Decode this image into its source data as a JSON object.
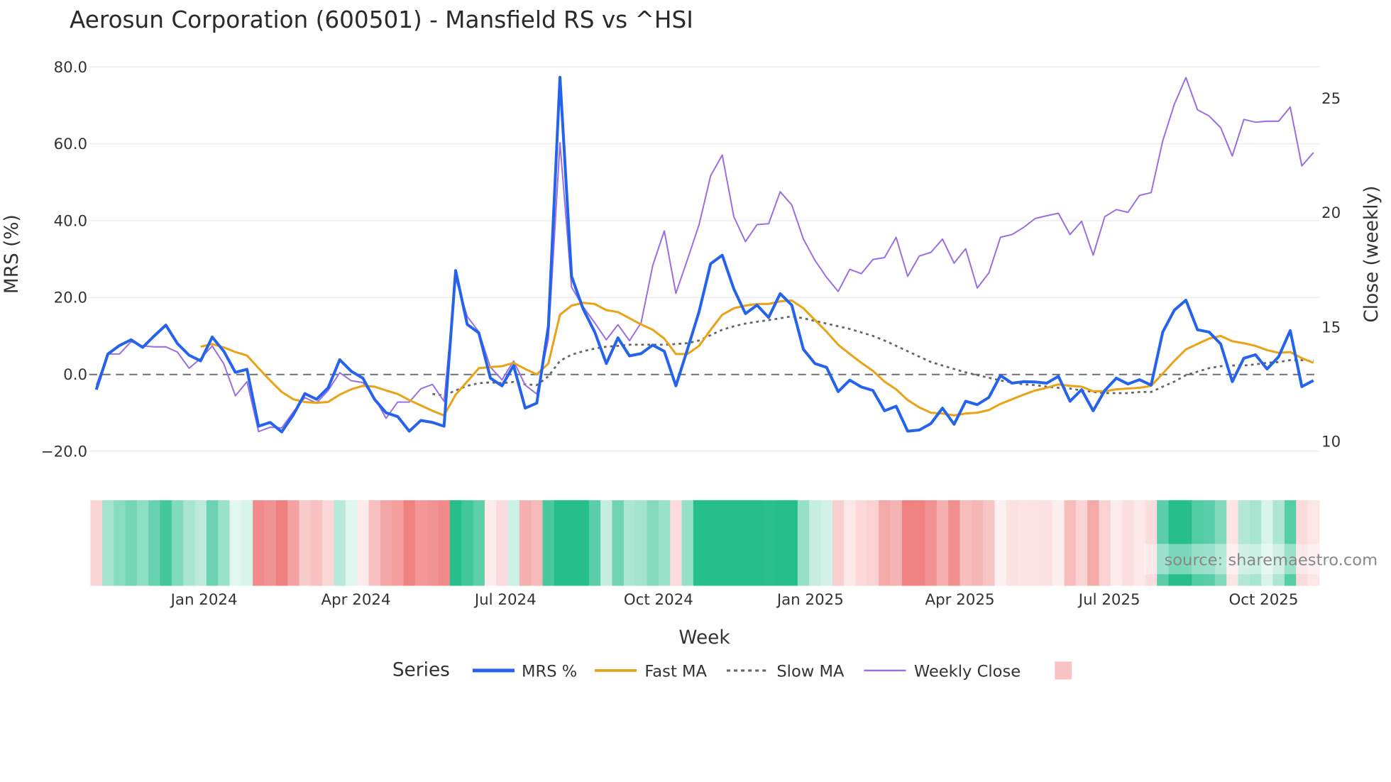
{
  "chart_data": {
    "type": "line",
    "title": "Aerosun Corporation (600501) - Mansfield RS vs ^HSI",
    "xlabel": "Week",
    "ylabel": "MRS (%)",
    "y2label": "Close (weekly)",
    "ylim": [
      -20,
      80
    ],
    "y2lim": [
      10,
      25
    ],
    "yticks": [
      "80.0",
      "60.0",
      "40.0",
      "20.0",
      "0.0",
      "−20.0"
    ],
    "ytick_values": [
      80,
      60,
      40,
      20,
      0,
      -20
    ],
    "y2ticks": [
      "25",
      "20",
      "15",
      "10"
    ],
    "y2tick_values": [
      25,
      20,
      15,
      10
    ],
    "xticks": [
      {
        "label": "Jan 2024",
        "week": 9.3
      },
      {
        "label": "Apr 2024",
        "week": 22.4
      },
      {
        "label": "Jul 2024",
        "week": 35.3
      },
      {
        "label": "Oct 2024",
        "week": 48.5
      },
      {
        "label": "Jan 2025",
        "week": 61.6
      },
      {
        "label": "Apr 2025",
        "week": 74.5
      },
      {
        "label": "Jul 2025",
        "week": 87.4
      },
      {
        "label": "Oct 2025",
        "week": 100.7
      }
    ],
    "grid": true,
    "legend_title": "Series",
    "legend_position": "bottom",
    "zero_line": 0,
    "series": [
      {
        "name": "MRS %",
        "color": "#2563eb",
        "axis": "left",
        "start": 0,
        "values": [
          -4,
          5.3,
          7.5,
          9,
          7,
          10,
          12.8,
          8,
          5,
          3.5,
          9.7,
          6,
          0.5,
          1.3,
          -13.5,
          -12.5,
          -15,
          -10.5,
          -5,
          -6.5,
          -3.5,
          3.8,
          0.8,
          -1,
          -6.5,
          -10,
          -11,
          -14.8,
          -12,
          -12.5,
          -13.5,
          27,
          13,
          10.8,
          -1,
          -3,
          2.3,
          -8.8,
          -7.5,
          12.5,
          77.3,
          25.5,
          17,
          11,
          2.8,
          9.5,
          4.8,
          5.4,
          7.6,
          6,
          -3,
          6.5,
          16.3,
          28.8,
          31,
          22.2,
          15.8,
          18,
          14.8,
          21,
          18,
          6.5,
          2.8,
          1.8,
          -4.5,
          -1.5,
          -3.3,
          -4.2,
          -9.5,
          -8.3,
          -14.8,
          -14.5,
          -12.8,
          -8.8,
          -13,
          -7,
          -7.9,
          -6,
          -0.3,
          -2.3,
          -1.9,
          -2,
          -2.3,
          -0.5,
          -7,
          -4,
          -9.5,
          -4.2,
          -1,
          -2.5,
          -1.4,
          -2.8,
          11,
          16.7,
          19.3,
          11.6,
          11,
          7.9,
          -1.9,
          4.2,
          5.1,
          1.4,
          4.6,
          11.4,
          -3.2,
          -1.6
        ]
      },
      {
        "name": "Fast MA",
        "color": "#e8a317",
        "axis": "left",
        "start": 9,
        "values": [
          7.2,
          7.9,
          7,
          5.8,
          4.9,
          1.6,
          -1.6,
          -4.6,
          -6.5,
          -7.2,
          -7.4,
          -7.2,
          -5.3,
          -3.9,
          -3,
          -3.2,
          -4.2,
          -5.1,
          -6.7,
          -8.1,
          -9.5,
          -10.7,
          -5.3,
          -1.9,
          1.6,
          1.9,
          2.1,
          3,
          1.4,
          0,
          2.8,
          15.5,
          17.9,
          18.6,
          18.3,
          16.7,
          16.2,
          14.6,
          13,
          11.6,
          9.3,
          5.3,
          5.3,
          7.4,
          11.6,
          15.5,
          17.2,
          17.9,
          18.3,
          18.3,
          19,
          19.2,
          17.2,
          14.1,
          11.1,
          7.7,
          5.3,
          3,
          0.9,
          -1.9,
          -3.9,
          -6.7,
          -8.6,
          -10,
          -10.2,
          -10.7,
          -10.2,
          -10,
          -9.3,
          -7.7,
          -6.5,
          -5.3,
          -4.2,
          -3.5,
          -2.6,
          -3,
          -3.2,
          -4.4,
          -4.4,
          -3.9,
          -3.7,
          -3.5,
          -3,
          0.2,
          3.5,
          6.5,
          7.9,
          9.3,
          10,
          8.6,
          8.1,
          7.4,
          6.3,
          5.6,
          5.8,
          4.2,
          3
        ]
      },
      {
        "name": "Slow MA",
        "color": "#666666",
        "axis": "left",
        "start": 29,
        "dash": true,
        "values": [
          -5.1,
          -5.5,
          -4.2,
          -3,
          -2.3,
          -2.1,
          -2.3,
          -2,
          -2.6,
          -2.8,
          -0.5,
          3.5,
          5.1,
          6,
          6.7,
          7.2,
          7.4,
          7.7,
          7.7,
          7.7,
          7.7,
          7.9,
          8.1,
          8.8,
          10.2,
          11.6,
          12.5,
          13.2,
          13.7,
          14.1,
          14.6,
          15.1,
          14.6,
          13.9,
          13.2,
          12.5,
          11.8,
          10.9,
          10,
          8.8,
          7.4,
          6,
          4.6,
          3.2,
          2.3,
          1.4,
          0.5,
          -0.2,
          -0.9,
          -1.6,
          -2.1,
          -2.6,
          -2.8,
          -3.2,
          -3.5,
          -3.7,
          -4.2,
          -4.6,
          -4.9,
          -4.9,
          -4.9,
          -4.6,
          -4.6,
          -3.2,
          -1.9,
          -0.2,
          0.7,
          1.6,
          2.1,
          2.3,
          2.3,
          2.6,
          3,
          3.2,
          3.7,
          3.7,
          3.5
        ]
      },
      {
        "name": "Weekly Close",
        "color": "#9b6fe0",
        "axis": "right",
        "start": 0,
        "values": [
          12.46,
          13.82,
          13.82,
          14.36,
          14.17,
          14.13,
          14.13,
          13.9,
          13.2,
          13.62,
          14.17,
          13.39,
          11.99,
          12.61,
          10.43,
          10.62,
          10.59,
          11.29,
          11.91,
          11.68,
          12.22,
          13,
          12.65,
          12.57,
          11.91,
          11.01,
          11.72,
          11.72,
          12.3,
          12.49,
          11.75,
          17.13,
          15.46,
          14.79,
          13.24,
          12.69,
          13.51,
          12.46,
          12.07,
          14.48,
          23.05,
          16.74,
          15.88,
          15.18,
          14.44,
          15.1,
          14.4,
          15.18,
          17.68,
          19.2,
          16.47,
          17.95,
          19.47,
          21.61,
          22.51,
          19.82,
          18.73,
          19.47,
          19.51,
          20.91,
          20.33,
          18.84,
          17.91,
          17.17,
          16.55,
          17.52,
          17.33,
          17.95,
          18.03,
          18.92,
          17.21,
          18.1,
          18.26,
          18.84,
          17.79,
          18.42,
          16.7,
          17.36,
          18.92,
          19.04,
          19.35,
          19.74,
          19.86,
          19.97,
          19.04,
          19.62,
          18.14,
          19.82,
          20.13,
          20.01,
          20.75,
          20.87,
          23.13,
          24.73,
          25.9,
          24.49,
          24.22,
          23.71,
          22.47,
          24.07,
          23.95,
          23.99,
          23.99,
          24.61,
          22.04,
          22.62
        ]
      }
    ],
    "heatmap": {
      "source_series": "MRS %",
      "positive_color": "#26bf8c",
      "negative_color": "#f08080"
    },
    "legend_swatch_color": "#f7c3c3",
    "annotation": "source: sharemaestro.com"
  }
}
